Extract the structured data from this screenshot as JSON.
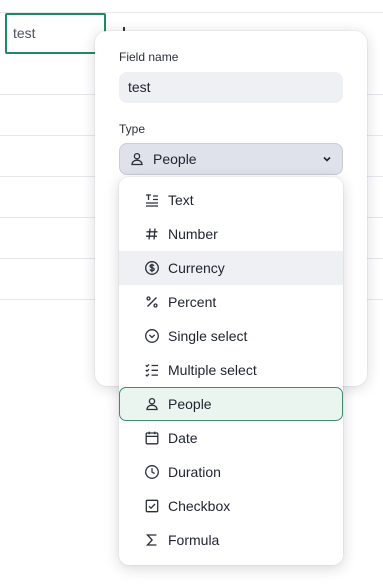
{
  "grid": {
    "cell_value": "test"
  },
  "popover": {
    "field_name_label": "Field name",
    "field_name_value": "test",
    "type_label": "Type",
    "selected_type": "People"
  },
  "dropdown": {
    "options": [
      {
        "label": "Text",
        "icon": "text-icon",
        "state": "default"
      },
      {
        "label": "Number",
        "icon": "hash-icon",
        "state": "default"
      },
      {
        "label": "Currency",
        "icon": "dollar-circle-icon",
        "state": "hover"
      },
      {
        "label": "Percent",
        "icon": "percent-icon",
        "state": "default"
      },
      {
        "label": "Single select",
        "icon": "chevron-circle-icon",
        "state": "default"
      },
      {
        "label": "Multiple select",
        "icon": "checklist-icon",
        "state": "default"
      },
      {
        "label": "People",
        "icon": "person-icon",
        "state": "selected"
      },
      {
        "label": "Date",
        "icon": "calendar-icon",
        "state": "default"
      },
      {
        "label": "Duration",
        "icon": "clock-icon",
        "state": "default"
      },
      {
        "label": "Checkbox",
        "icon": "checkbox-icon",
        "state": "default"
      },
      {
        "label": "Formula",
        "icon": "sigma-icon",
        "state": "default"
      }
    ]
  },
  "colors": {
    "accent": "#1f8a63",
    "selected_bg": "#eaf5ef",
    "hover_bg": "#eef0f4"
  }
}
